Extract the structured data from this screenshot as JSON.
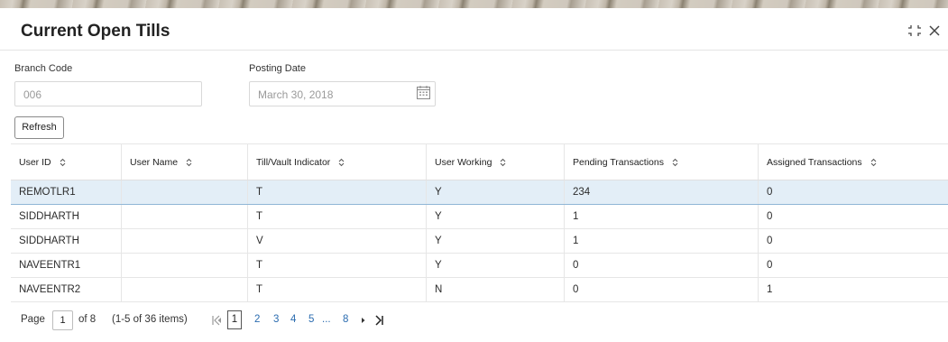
{
  "dialog": {
    "title": "Current Open Tills"
  },
  "form": {
    "branch_code_label": "Branch Code",
    "branch_code_value": "006",
    "posting_date_label": "Posting Date",
    "posting_date_value": "March 30, 2018",
    "refresh_label": "Refresh"
  },
  "table": {
    "columns": [
      "User ID",
      "User Name",
      "Till/Vault Indicator",
      "User Working",
      "Pending Transactions",
      "Assigned Transactions"
    ],
    "rows": [
      [
        "REMOTLR1",
        "",
        "T",
        "Y",
        "234",
        "0"
      ],
      [
        "SIDDHARTH",
        "",
        "T",
        "Y",
        "1",
        "0"
      ],
      [
        "SIDDHARTH",
        "",
        "V",
        "Y",
        "1",
        "0"
      ],
      [
        "NAVEENTR1",
        "",
        "T",
        "Y",
        "0",
        "0"
      ],
      [
        "NAVEENTR2",
        "",
        "T",
        "N",
        "0",
        "1"
      ]
    ],
    "selected_row": 0
  },
  "pagination": {
    "page_label": "Page",
    "current_page": "1",
    "of_total": "of 8",
    "item_range": "(1-5 of 36 items)",
    "pages": [
      "1",
      "2",
      "3",
      "4",
      "5",
      "...",
      "8"
    ]
  },
  "icons": {
    "minimize": "minimize-icon",
    "close": "close-icon",
    "calendar": "calendar-icon",
    "sort": "sort-icon",
    "first_page": "first-page-icon",
    "prev_page": "prev-page-icon",
    "next_page": "next-page-icon",
    "last_page": "last-page-icon"
  },
  "colors": {
    "selected_row_bg": "#e3eef7",
    "page_link": "#2b6cb0"
  }
}
